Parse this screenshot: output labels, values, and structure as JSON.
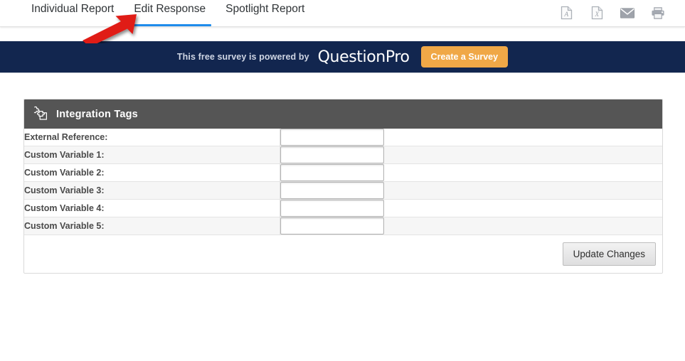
{
  "header": {
    "tabs": [
      {
        "label": "Individual Report",
        "active": false
      },
      {
        "label": "Edit Response",
        "active": true
      },
      {
        "label": "Spotlight Report",
        "active": false
      }
    ],
    "icons": [
      {
        "name": "pdf-export-icon",
        "glyph": "A",
        "title": "Export to PDF"
      },
      {
        "name": "excel-export-icon",
        "glyph": "X",
        "title": "Export to Excel"
      },
      {
        "name": "email-icon",
        "glyph": "envelope",
        "title": "Email"
      },
      {
        "name": "print-icon",
        "glyph": "printer",
        "title": "Print"
      }
    ],
    "active_tab_underline_color": "#1f8ceb"
  },
  "banner": {
    "text": "This free survey is powered by",
    "logo": "QuestionPro",
    "button_label": "Create a Survey",
    "background_color": "#12264f",
    "button_color": "#f0a847"
  },
  "panel": {
    "title": "Integration Tags",
    "icon": "puzzle-piece-icon",
    "header_color": "#555555",
    "rows": [
      {
        "label": "External Reference:",
        "value": "",
        "placeholder": ""
      },
      {
        "label": "Custom Variable 1:",
        "value": "",
        "placeholder": ""
      },
      {
        "label": "Custom Variable 2:",
        "value": "",
        "placeholder": ""
      },
      {
        "label": "Custom Variable 3:",
        "value": "",
        "placeholder": ""
      },
      {
        "label": "Custom Variable 4:",
        "value": "",
        "placeholder": ""
      },
      {
        "label": "Custom Variable 5:",
        "value": "",
        "placeholder": ""
      }
    ],
    "update_button_label": "Update Changes"
  },
  "annotation": {
    "type": "arrow",
    "color": "#e01b18",
    "points_to": "Edit Response"
  }
}
